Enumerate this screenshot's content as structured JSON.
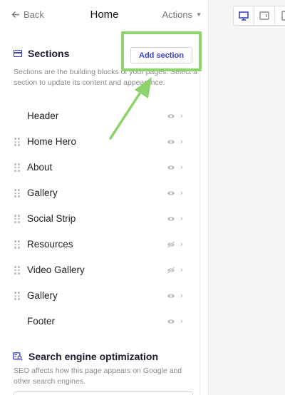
{
  "header": {
    "back_label": "Back",
    "title": "Home",
    "actions_label": "Actions"
  },
  "sections_panel": {
    "heading": "Sections",
    "add_button": "Add section",
    "description": "Sections are the building blocks of your pages. Select a section to update its content and appearance.",
    "items": [
      {
        "label": "Header",
        "visible": true,
        "draggable": false
      },
      {
        "label": "Home Hero",
        "visible": true,
        "draggable": true
      },
      {
        "label": "About",
        "visible": true,
        "draggable": true
      },
      {
        "label": "Gallery",
        "visible": true,
        "draggable": true
      },
      {
        "label": "Social Strip",
        "visible": true,
        "draggable": true
      },
      {
        "label": "Resources",
        "visible": false,
        "draggable": true
      },
      {
        "label": "Video Gallery",
        "visible": false,
        "draggable": true
      },
      {
        "label": "Gallery",
        "visible": true,
        "draggable": true
      },
      {
        "label": "Footer",
        "visible": true,
        "draggable": false
      }
    ]
  },
  "seo": {
    "heading": "Search engine optimization",
    "description": "SEO affects how this page appears on Google and other search engines."
  },
  "colors": {
    "accent": "#3a42c8",
    "highlight": "#8ed36b"
  },
  "device_toggle": {
    "icons": [
      "desktop-icon",
      "tablet-icon",
      "mobile-icon"
    ],
    "selected": "desktop-icon"
  }
}
